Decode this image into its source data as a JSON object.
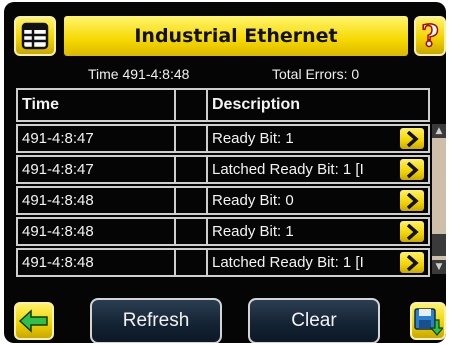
{
  "header": {
    "title": "Industrial Ethernet",
    "menu_icon": "menu-grid-icon",
    "help_icon": "question-mark-icon",
    "help_label": "?"
  },
  "status": {
    "time": "Time 491-4:8:48",
    "total_errors": "Total Errors: 0"
  },
  "table": {
    "columns": [
      "Time",
      "",
      "Description"
    ],
    "rows": [
      {
        "time": "491-4:8:47",
        "description": "Ready Bit: 1"
      },
      {
        "time": "491-4:8:47",
        "description": "Latched Ready Bit: 1 [I"
      },
      {
        "time": "491-4:8:48",
        "description": "Ready Bit: 0"
      },
      {
        "time": "491-4:8:48",
        "description": "Ready Bit: 1"
      },
      {
        "time": "491-4:8:48",
        "description": "Latched Ready Bit: 1 [I"
      }
    ]
  },
  "footer": {
    "back_icon": "back-arrow-icon",
    "refresh_label": "Refresh",
    "clear_label": "Clear",
    "save_icon": "save-disk-icon"
  },
  "colors": {
    "accent": "#f6d800",
    "background": "#050505",
    "button_dark": "#132232"
  }
}
